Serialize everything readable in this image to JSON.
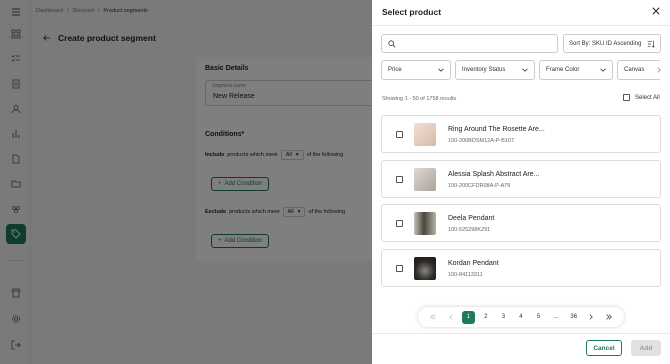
{
  "breadcrumb": [
    "Dashboard",
    "Discount",
    "Product segments"
  ],
  "page": {
    "title": "Create product segment",
    "basic_details": "Basic Details",
    "segment_name_label": "Segment name",
    "segment_name_value": "New Release",
    "conditions_title": "Conditions*",
    "include_text": "Include",
    "include_rest": "products which meet",
    "include_select": "All",
    "include_tail": "of the following",
    "exclude_text": "Exclude",
    "exclude_rest": "products which meet",
    "exclude_select": "All",
    "exclude_tail": "of the following",
    "add_condition": "Add Condition"
  },
  "drawer": {
    "title": "Select product",
    "search_placeholder": "",
    "sort_label": "Sort By: SKU ID Ascending",
    "filters": [
      "Price",
      "Inventory Status",
      "Frame Color",
      "Canvas"
    ],
    "showing": "Showing 1 - 50 of 1758 results",
    "select_all": "Select All",
    "products": [
      {
        "name": "Ring Around The Rosette Are...",
        "sku": "100-200BDSM12A-P-B107",
        "thumb_color": "#e8d4c8"
      },
      {
        "name": "Alessia Splash Abstract Are...",
        "sku": "100-200CFDR08A-P-A79",
        "thumb_color": "#c9c4bd"
      },
      {
        "name": "Deela Pendant",
        "sku": "100-525298K291",
        "thumb_color": "#6f6a63"
      },
      {
        "name": "Kordan Pendant",
        "sku": "100-84113311",
        "thumb_color": "#3a3836"
      }
    ],
    "pages": [
      "1",
      "2",
      "3",
      "4",
      "5",
      "...",
      "36"
    ],
    "current_page": "1",
    "cancel": "Cancel",
    "add": "Add"
  },
  "colors": {
    "accent": "#1d7a5a"
  }
}
